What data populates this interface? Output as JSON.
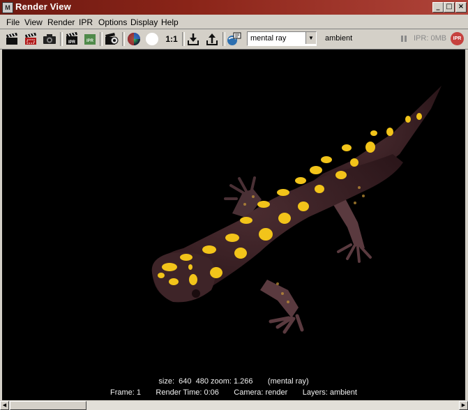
{
  "window": {
    "title": "Render View",
    "icon": "maya-app-icon"
  },
  "menu": [
    "File",
    "View",
    "Render",
    "IPR",
    "Options",
    "Display",
    "Help"
  ],
  "toolbar": {
    "ratio_label": "1:1",
    "renderer": "mental ray",
    "layer": "ambient",
    "ipr_memory": "IPR: 0MB",
    "ipr_badge": "IPR"
  },
  "status": {
    "line1": "size:  640  480 zoom: 1.266       (mental ray)",
    "line2": "Frame: 1       Render Time: 0:06       Camera: render       Layers: ambient"
  },
  "colors": {
    "titlebar": "#8a2418",
    "background": "#000000",
    "spots": "#f2c41a",
    "body": "#3a2226"
  }
}
